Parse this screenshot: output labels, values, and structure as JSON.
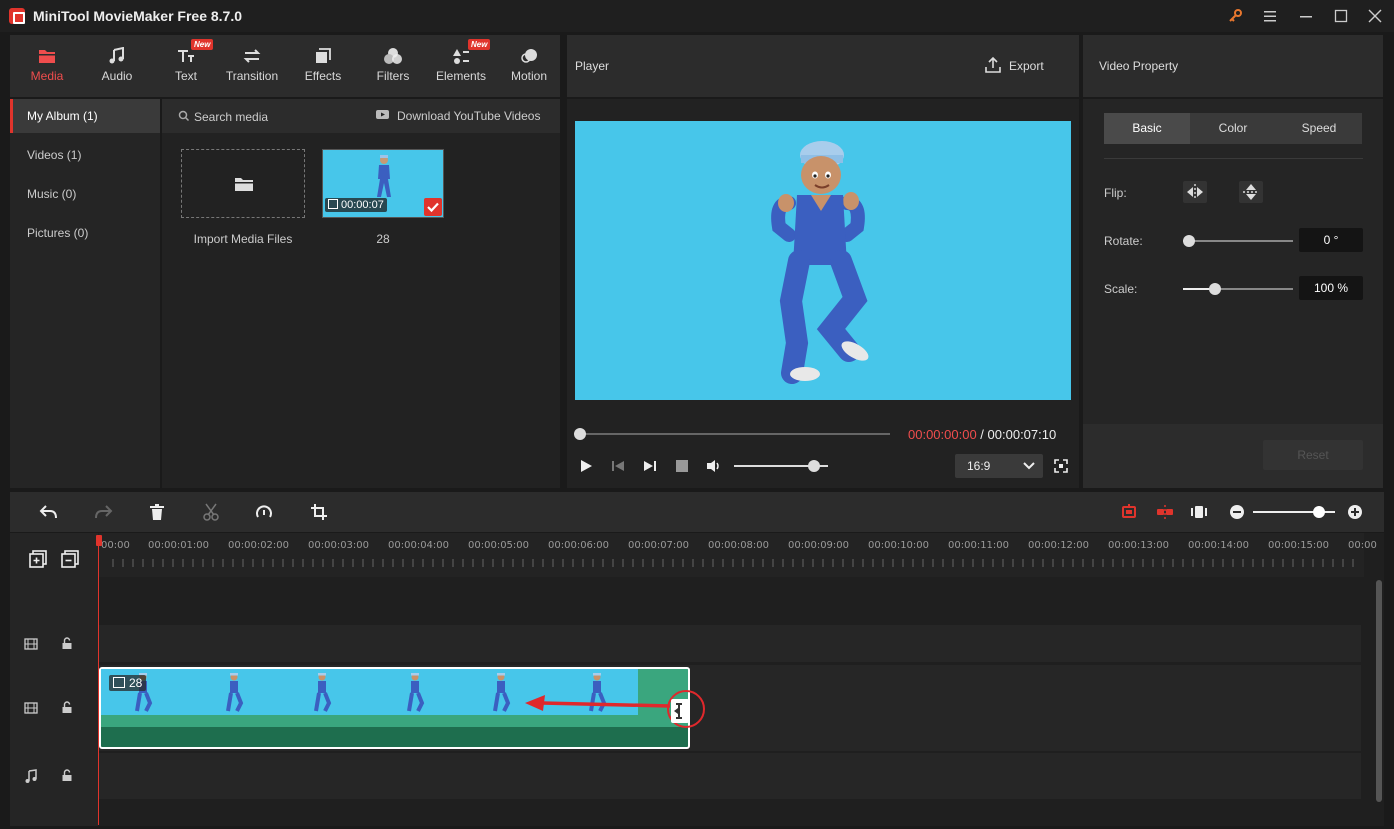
{
  "app": {
    "title": "MiniTool MovieMaker Free 8.7.0"
  },
  "toolbar": {
    "items": [
      {
        "label": "Media",
        "icon": "folder-icon",
        "active": true
      },
      {
        "label": "Audio",
        "icon": "music-icon"
      },
      {
        "label": "Text",
        "icon": "text-icon",
        "badge": "New"
      },
      {
        "label": "Transition",
        "icon": "transition-icon"
      },
      {
        "label": "Effects",
        "icon": "effects-icon"
      },
      {
        "label": "Filters",
        "icon": "filters-icon"
      },
      {
        "label": "Elements",
        "icon": "elements-icon",
        "badge": "New"
      },
      {
        "label": "Motion",
        "icon": "motion-icon"
      }
    ]
  },
  "album": {
    "items": [
      {
        "label": "My Album (1)",
        "active": true
      },
      {
        "label": "Videos (1)"
      },
      {
        "label": "Music (0)"
      },
      {
        "label": "Pictures (0)"
      }
    ]
  },
  "media": {
    "search_label": "Search media",
    "download_label": "Download YouTube Videos",
    "import_label": "Import Media Files",
    "clip_duration": "00:00:07",
    "clip_name": "28"
  },
  "player": {
    "title": "Player",
    "export_label": "Export",
    "current_time": "00:00:00:00",
    "separator": " / ",
    "total_time": "00:00:07:10",
    "aspect_ratio": "16:9",
    "progress": 0,
    "volume": 0.85
  },
  "property": {
    "title": "Video Property",
    "tabs": [
      "Basic",
      "Color",
      "Speed"
    ],
    "flip_label": "Flip:",
    "rotate_label": "Rotate:",
    "rotate_value": "0 °",
    "scale_label": "Scale:",
    "scale_value": "100 %",
    "reset_label": "Reset"
  },
  "timeline": {
    "ticks": [
      "00:00",
      "00:00:01:00",
      "00:00:02:00",
      "00:00:03:00",
      "00:00:04:00",
      "00:00:05:00",
      "00:00:06:00",
      "00:00:07:00",
      "00:00:08:00",
      "00:00:09:00",
      "00:00:10:00",
      "00:00:11:00",
      "00:00:12:00",
      "00:00:13:00",
      "00:00:14:00",
      "00:00:15:00",
      "00:00"
    ],
    "clip_label": "28",
    "zoom": 0.8
  },
  "colors": {
    "accent": "#e0342c",
    "preview_bg": "#47c6ea",
    "clip_green": "#1e6e4e"
  }
}
